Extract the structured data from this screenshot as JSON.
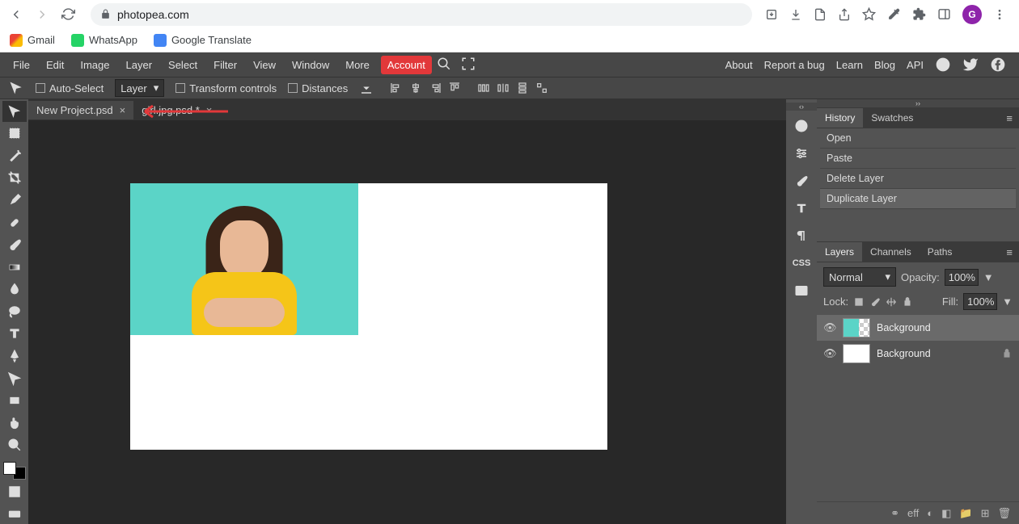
{
  "browser": {
    "url": "photopea.com",
    "bookmarks": [
      {
        "label": "Gmail"
      },
      {
        "label": "WhatsApp"
      },
      {
        "label": "Google Translate"
      }
    ],
    "avatar": "G"
  },
  "menu": {
    "items": [
      "File",
      "Edit",
      "Image",
      "Layer",
      "Select",
      "Filter",
      "View",
      "Window",
      "More"
    ],
    "account": "Account",
    "right": [
      "About",
      "Report a bug",
      "Learn",
      "Blog",
      "API"
    ]
  },
  "options": {
    "auto_select": "Auto-Select",
    "target": "Layer",
    "transform_controls": "Transform controls",
    "distances": "Distances"
  },
  "tabs": [
    {
      "name": "New Project.psd",
      "dirty": false
    },
    {
      "name": "girl.jpg.psd *",
      "dirty": true
    }
  ],
  "history": {
    "tab_history": "History",
    "tab_swatches": "Swatches",
    "items": [
      "Open",
      "Paste",
      "Delete Layer",
      "Duplicate Layer"
    ],
    "active_index": 3
  },
  "layers_panel": {
    "tab_layers": "Layers",
    "tab_channels": "Channels",
    "tab_paths": "Paths",
    "blend_mode": "Normal",
    "opacity_label": "Opacity:",
    "opacity_value": "100%",
    "lock_label": "Lock:",
    "fill_label": "Fill:",
    "fill_value": "100%",
    "layers": [
      {
        "name": "Background",
        "visible": true,
        "checker": true,
        "locked": false
      },
      {
        "name": "Background",
        "visible": true,
        "checker": false,
        "locked": true
      }
    ],
    "footer_eff": "eff"
  }
}
